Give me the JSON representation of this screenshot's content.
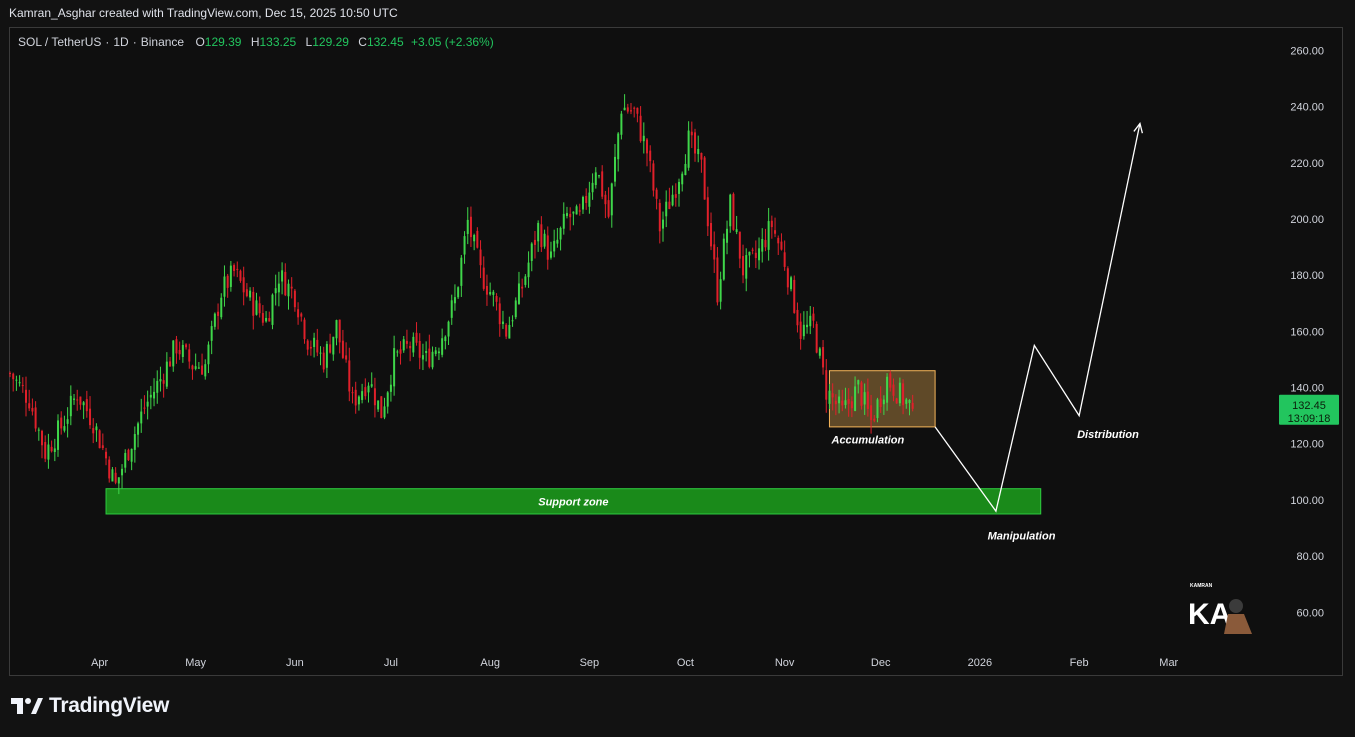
{
  "header": {
    "attribution": "Kamran_Asghar created with TradingView.com, Dec 15, 2025 10:50 UTC"
  },
  "symbol": {
    "name": "SOL / TetherUS",
    "interval": "1D",
    "exchange": "Binance",
    "open_label": "O",
    "open": "129.39",
    "high_label": "H",
    "high": "133.25",
    "low_label": "L",
    "low": "129.29",
    "close_label": "C",
    "close": "132.45",
    "change": "+3.05 (+2.36%)"
  },
  "price_tag": {
    "price": "132.45",
    "countdown": "13:09:18",
    "color": "#22c55e"
  },
  "colors": {
    "up": "#3fd64a",
    "down": "#e0202a",
    "zone": "#1a8a1a",
    "accum": "#f6b65a"
  },
  "footer": {
    "brand": "TradingView",
    "logo_icon": "tradingview-logo-icon"
  },
  "watermark": {
    "text": "KAMRAN",
    "initials": "KA",
    "icon": "author-avatar-icon"
  },
  "chart_data": {
    "type": "candlestick",
    "symbol": "SOL / TetherUS",
    "timeframe": "1D",
    "ylim": [
      48,
      268
    ],
    "y_ticks": [
      "260.00",
      "240.00",
      "220.00",
      "200.00",
      "180.00",
      "160.00",
      "140.00",
      "120.00",
      "100.00",
      "80.00",
      "60.00"
    ],
    "x_ticks": [
      "Apr",
      "May",
      "Jun",
      "Jul",
      "Aug",
      "Sep",
      "Oct",
      "Nov",
      "Dec",
      "2026",
      "Feb",
      "Mar"
    ],
    "x_tick_days": [
      0,
      30,
      61,
      91,
      122,
      153,
      183,
      214,
      244,
      275,
      306,
      334
    ],
    "xlim_days": [
      -28,
      365
    ],
    "close_path": [
      [
        -28,
        145
      ],
      [
        -22,
        136
      ],
      [
        -17,
        117
      ],
      [
        -12,
        126
      ],
      [
        -7,
        138
      ],
      [
        -2,
        128
      ],
      [
        5,
        105
      ],
      [
        9,
        118
      ],
      [
        14,
        133
      ],
      [
        19,
        143
      ],
      [
        24,
        155
      ],
      [
        29,
        148
      ],
      [
        33,
        148
      ],
      [
        38,
        174
      ],
      [
        42,
        181
      ],
      [
        47,
        171
      ],
      [
        52,
        164
      ],
      [
        56,
        180
      ],
      [
        61,
        173
      ],
      [
        65,
        157
      ],
      [
        70,
        150
      ],
      [
        74,
        162
      ],
      [
        79,
        135
      ],
      [
        84,
        143
      ],
      [
        88,
        131
      ],
      [
        92,
        150
      ],
      [
        97,
        155
      ],
      [
        102,
        150
      ],
      [
        106,
        156
      ],
      [
        111,
        171
      ],
      [
        115,
        199
      ],
      [
        119,
        181
      ],
      [
        123,
        172
      ],
      [
        127,
        160
      ],
      [
        132,
        176
      ],
      [
        137,
        197
      ],
      [
        141,
        186
      ],
      [
        146,
        201
      ],
      [
        150,
        200
      ],
      [
        155,
        219
      ],
      [
        159,
        201
      ],
      [
        163,
        240
      ],
      [
        167,
        238
      ],
      [
        171,
        224
      ],
      [
        175,
        197
      ],
      [
        180,
        212
      ],
      [
        184,
        228
      ],
      [
        188,
        218
      ],
      [
        193,
        174
      ],
      [
        197,
        205
      ],
      [
        201,
        182
      ],
      [
        205,
        186
      ],
      [
        210,
        198
      ],
      [
        214,
        185
      ],
      [
        219,
        160
      ],
      [
        223,
        162
      ],
      [
        227,
        139
      ],
      [
        232,
        131
      ],
      [
        237,
        140
      ],
      [
        241,
        128
      ],
      [
        246,
        143
      ],
      [
        251,
        136
      ],
      [
        254,
        132.45
      ]
    ],
    "zones": [
      {
        "label": "Support zone",
        "from_day": 2,
        "to_day": 294,
        "low": 95,
        "high": 104
      },
      {
        "label": "Accumulation",
        "from_day": 228,
        "to_day": 261,
        "low": 126,
        "high": 146
      }
    ],
    "projection": [
      [
        261,
        126
      ],
      [
        280,
        96
      ],
      [
        292,
        155
      ],
      [
        306,
        130
      ],
      [
        325,
        234
      ]
    ],
    "annotations": [
      {
        "label": "Accumulation",
        "day": 240,
        "value": 120
      },
      {
        "label": "Manipulation",
        "day": 288,
        "value": 86
      },
      {
        "label": "Distribution",
        "day": 315,
        "value": 122
      }
    ],
    "last_price": 132.45,
    "grid": false
  }
}
